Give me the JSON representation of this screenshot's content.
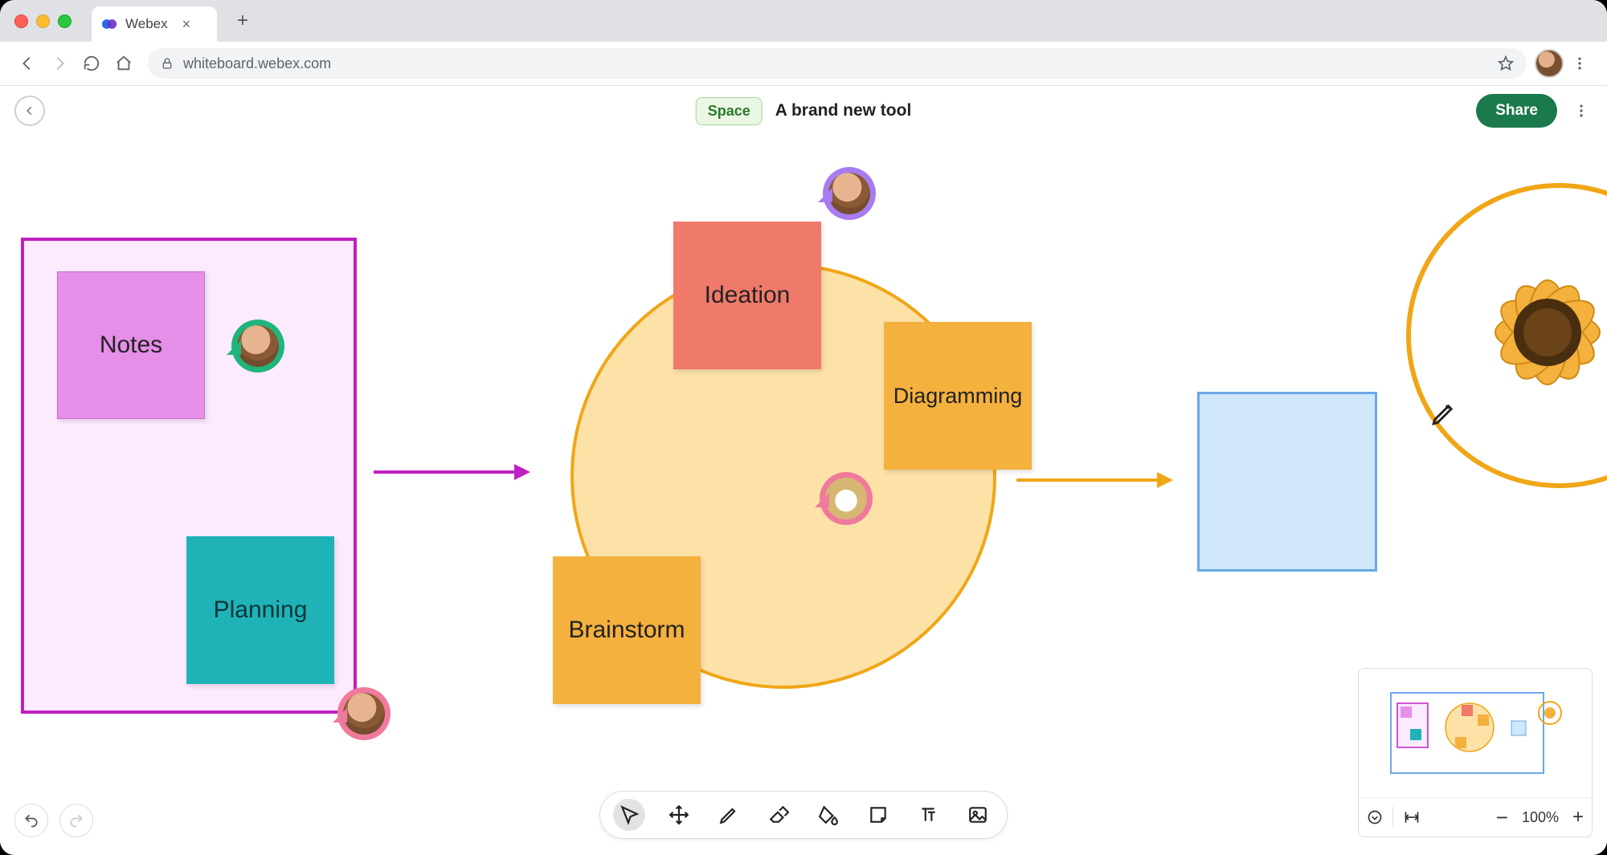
{
  "browser": {
    "tab_title": "Webex",
    "url": "whiteboard.webex.com"
  },
  "header": {
    "space_label": "Space",
    "doc_title": "A brand new tool",
    "share_label": "Share"
  },
  "canvas": {
    "frame_notes": {
      "color": "#c020c0"
    },
    "sticky_notes": {
      "label": "Notes",
      "bg": "#e58fe8"
    },
    "sticky_planning": {
      "label": "Planning",
      "bg": "#1fb3b8"
    },
    "sticky_ideation": {
      "label": "Ideation",
      "bg": "#f07a6a"
    },
    "sticky_diagramming": {
      "label": "Diagramming",
      "bg": "#f4b13e"
    },
    "sticky_brainstorm": {
      "label": "Brainstorm",
      "bg": "#f4b13e"
    },
    "circle_center": {
      "fill": "#fde2a8",
      "stroke": "#f0a616"
    },
    "circle_right": {
      "stroke": "#f0a616"
    },
    "rect_blue": {
      "fill": "#cfe6fb",
      "stroke": "#6aa8e8"
    },
    "arrow_purple": {
      "color": "#c020c0"
    },
    "arrow_orange": {
      "color": "#f0a616"
    },
    "presence": {
      "green": "#1fb57c",
      "purple": "#a77cf0",
      "pink": "#f07a9c",
      "rose": "#f07a9c"
    }
  },
  "tools": {
    "select": "select",
    "pan": "pan",
    "pen": "pen",
    "eraser": "eraser",
    "fill": "fill",
    "sticky": "sticky",
    "text": "text",
    "image": "image"
  },
  "zoom": {
    "level": "100%"
  }
}
